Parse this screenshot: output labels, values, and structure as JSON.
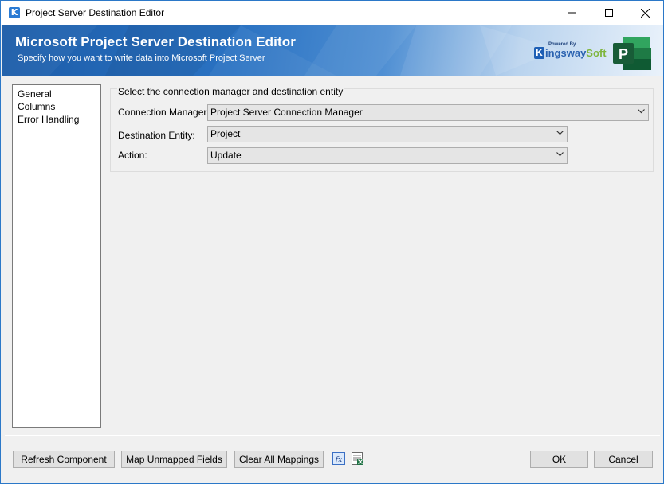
{
  "window": {
    "title": "Project Server Destination Editor",
    "app_icon_letter": "K"
  },
  "banner": {
    "title": "Microsoft Project Server Destination Editor",
    "subtitle": "Specify how you want to write data into Microsoft Project Server",
    "logo_powered": "Powered By",
    "logo_k": "K",
    "logo_ingsway": "ingsway",
    "logo_soft": "Soft",
    "project_logo_letter": "P"
  },
  "nav": {
    "items": [
      "General",
      "Columns",
      "Error Handling"
    ]
  },
  "connection": {
    "group_title": "Select the connection manager and destination entity",
    "connection_manager_label": "Connection Manager:",
    "connection_manager_value": "Project Server Connection Manager",
    "destination_entity_label": "Destination Entity:",
    "destination_entity_value": "Project",
    "action_label": "Action:",
    "action_value": "Update"
  },
  "buttons": {
    "refresh": "Refresh Component",
    "map_unmapped": "Map Unmapped Fields",
    "clear_all": "Clear All Mappings",
    "ok": "OK",
    "cancel": "Cancel",
    "fx_icon_text": "fx"
  },
  "colors": {
    "accent": "#2a7bd4",
    "project_green": "#217346"
  }
}
